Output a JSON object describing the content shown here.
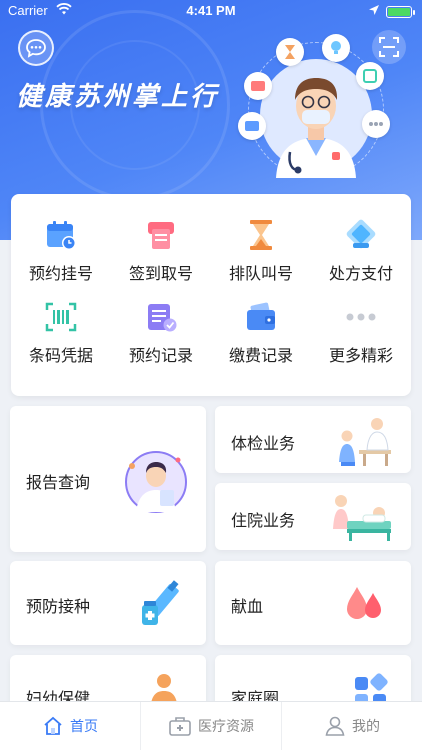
{
  "status_bar": {
    "carrier": "Carrier",
    "time": "4:41 PM"
  },
  "header": {
    "title": "健康苏州掌上行"
  },
  "quick_grid": [
    {
      "label": "预约挂号",
      "icon": "calendar-clock-icon"
    },
    {
      "label": "签到取号",
      "icon": "ticket-machine-icon"
    },
    {
      "label": "排队叫号",
      "icon": "hourglass-icon"
    },
    {
      "label": "处方支付",
      "icon": "prescription-pay-icon"
    },
    {
      "label": "条码凭据",
      "icon": "barcode-scan-icon"
    },
    {
      "label": "预约记录",
      "icon": "appointment-record-icon"
    },
    {
      "label": "缴费记录",
      "icon": "wallet-icon"
    },
    {
      "label": "更多精彩",
      "icon": "more-dots-icon"
    }
  ],
  "services": {
    "report": "报告查询",
    "checkup": "体检业务",
    "inpatient": "住院业务",
    "vaccine": "预防接种",
    "blood": "献血",
    "maternal": "妇幼保健",
    "family": "家庭圈"
  },
  "tabbar": [
    {
      "label": "首页",
      "icon": "home-icon",
      "active": true
    },
    {
      "label": "医疗资源",
      "icon": "medical-kit-icon",
      "active": false
    },
    {
      "label": "我的",
      "icon": "user-icon",
      "active": false
    }
  ],
  "colors": {
    "primary": "#3a7bf6",
    "header_bg": "#4f86f7",
    "background": "#eef1f6"
  }
}
